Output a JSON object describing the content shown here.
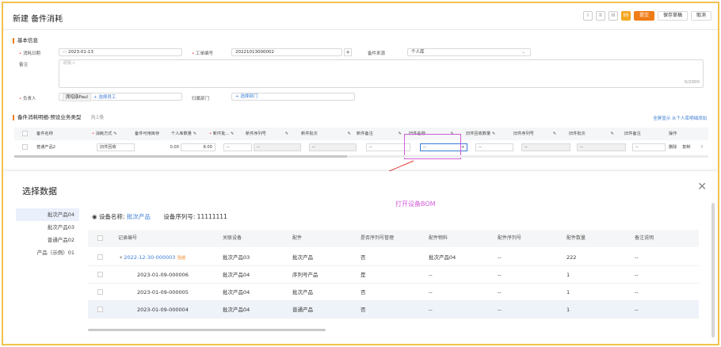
{
  "header": {
    "title": "新建 备件消耗",
    "view_icons": [
      "I",
      "II",
      "III",
      "IIII"
    ],
    "submit_label": "提交",
    "save_draft_label": "保存草稿",
    "cancel_label": "取消"
  },
  "basic": {
    "section_title": "基本信息",
    "date_label": "消耗日期",
    "date_value": "2023-01-13",
    "work_order_label": "工单编号",
    "work_order_value": "20221013000002",
    "source_label": "备件来源",
    "source_value": "个人库",
    "remark_label": "备注",
    "remark_placeholder": "请输入",
    "remark_count": "0/2000",
    "owner_label": "负责人",
    "owner_value": "席绍康Paul",
    "owner_add": "+ 选择员工",
    "dept_label": "归属部门",
    "dept_add": "+ 选择部门"
  },
  "parts": {
    "section_title": "备件消耗明细-预设业务类型",
    "count": "共1条",
    "show_all": "全屏显示",
    "add_from_personal": "从个人库明细添加",
    "columns": [
      "备件名称",
      "消耗方式",
      "备件可用库存",
      "个人库数量",
      "新件批...",
      "新件序列号",
      "新件批次",
      "新件备注",
      "旧件名称",
      "旧件回收数量",
      "旧件序列号",
      "旧件批次",
      "旧件备注",
      "操作"
    ],
    "row": {
      "name": "普通产品2",
      "method": "旧件回收",
      "stock": "0.00",
      "qty": "8.00",
      "dash": "--",
      "delete": "删除",
      "copy": "复制"
    }
  },
  "dialog": {
    "title": "选择数据",
    "annotation": "打开设备BOM",
    "side_items": [
      "批次产品04",
      "批次产品03",
      "普通产品02",
      "产品（示例）01"
    ],
    "device_name_label": "设备名称:",
    "device_name_value": "批次产品",
    "serial_label": "设备序列号:",
    "serial_value": "11111111",
    "columns": [
      "记录编号",
      "关联设备",
      "配件",
      "是否序列号管理",
      "配件物料",
      "配件序列号",
      "配件数量",
      "备注说明"
    ],
    "rows": [
      {
        "record": "2022-12-30-000003",
        "badge": "当前",
        "device": "批次产品03",
        "part": "批次产品",
        "serial_mgmt": "否",
        "material": "批次产品04",
        "part_serial": "--",
        "qty": "222",
        "remark": "--"
      },
      {
        "record": "2023-01-09-000006",
        "badge": "",
        "device": "批次产品04",
        "part": "序列号产品",
        "serial_mgmt": "是",
        "material": "--",
        "part_serial": "--",
        "qty": "1",
        "remark": "--"
      },
      {
        "record": "2023-01-09-000005",
        "badge": "",
        "device": "批次产品04",
        "part": "批次产品",
        "serial_mgmt": "否",
        "material": "--",
        "part_serial": "--",
        "qty": "1",
        "remark": "--"
      },
      {
        "record": "2023-01-09-000004",
        "badge": "",
        "device": "批次产品04",
        "part": "普通产品",
        "serial_mgmt": "否",
        "material": "--",
        "part_serial": "--",
        "qty": "1",
        "remark": "--"
      }
    ]
  },
  "colors": {
    "accent": "#f07c17",
    "link": "#3a7bd5",
    "highlight": "#d35bd8",
    "frame": "#f2c24d"
  }
}
